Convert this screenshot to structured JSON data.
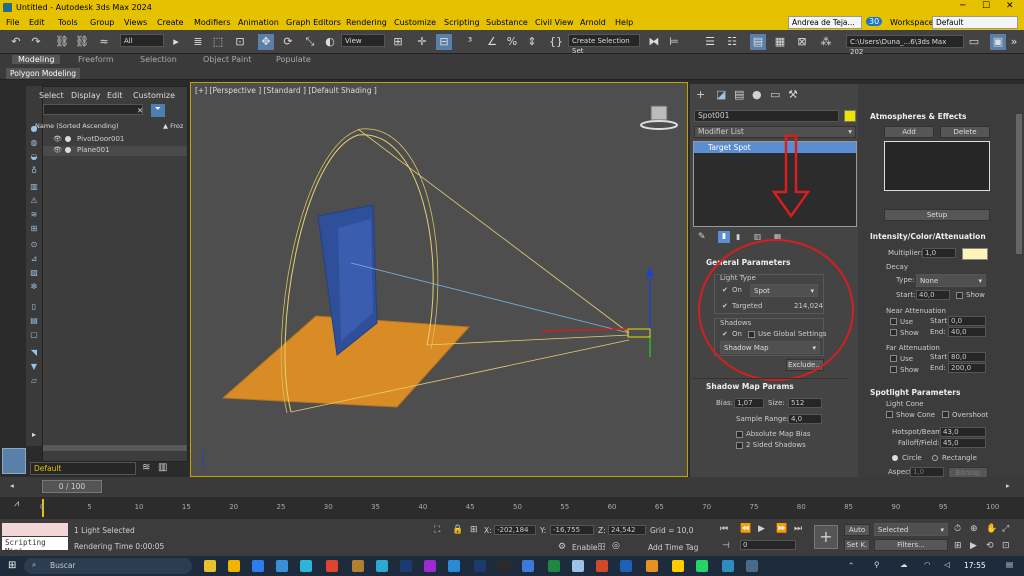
{
  "window": {
    "title": "Untitled - Autodesk 3ds Max 2024",
    "user": "Andrea de Teja...",
    "badge": "30",
    "workspaces_label": "Workspaces:",
    "workspace": "Default"
  },
  "menu": [
    "File",
    "Edit",
    "Tools",
    "Group",
    "Views",
    "Create",
    "Modifiers",
    "Animation",
    "Graph Editors",
    "Rendering",
    "Customize",
    "Scripting",
    "Substance",
    "Civil View",
    "Arnold",
    "Help"
  ],
  "toolbar": {
    "filter": "All",
    "refcoord": "View",
    "selset": "Create Selection Set",
    "path": "C:\\Users\\Duna_...6\\3ds Max 202"
  },
  "ribbon": {
    "tabs": [
      "Modeling",
      "Freeform",
      "Selection",
      "Object Paint",
      "Populate"
    ],
    "sub": "Polygon Modeling"
  },
  "scene": {
    "menu": [
      "Select",
      "Display",
      "Edit",
      "Customize"
    ],
    "column": "Name (Sorted Ascending)",
    "column2": "▲ Froz",
    "items": [
      "PivotDoor001",
      "Plane001"
    ],
    "layer": "Default"
  },
  "viewport": {
    "label": "[+] [Perspective ] [Standard ] [Default Shading ]"
  },
  "command": {
    "object_name": "Spot001",
    "object_color": "#f2e200",
    "modifier_list": "Modifier List",
    "stack_item": "Target Spot",
    "general": {
      "title": "General Parameters",
      "light_type": "Light Type",
      "on": "On",
      "type": "Spot",
      "targeted": "Targeted",
      "target_dist": "214,024",
      "shadows": "Shadows",
      "shadows_on": "On",
      "global": "Use Global Settings",
      "shadow_type": "Shadow Map",
      "exclude": "Exclude..."
    },
    "shadowmap": {
      "title": "Shadow Map Params",
      "bias_label": "Bias:",
      "bias": "1,07",
      "size_label": "Size:",
      "size": "512",
      "sample_label": "Sample Range:",
      "sample": "4,0",
      "abs": "Absolute Map Bias",
      "twosided": "2 Sided Shadows"
    }
  },
  "rollout": {
    "atmos": {
      "title": "Atmospheres & Effects",
      "add": "Add",
      "delete": "Delete",
      "setup": "Setup"
    },
    "intensity": {
      "title": "Intensity/Color/Attenuation",
      "mult_label": "Multiplier:",
      "mult": "1,0",
      "color": "#fff3b8",
      "decay": "Decay",
      "type_label": "Type:",
      "type": "None",
      "start_label": "Start:",
      "start": "40,0",
      "show": "Show",
      "near": "Near Attenuation",
      "use": "Use",
      "start2": "0,0",
      "end_label": "End:",
      "end2": "40,0",
      "far": "Far Attenuation",
      "start3": "80,0",
      "end3": "200,0"
    },
    "spot": {
      "title": "Spotlight Parameters",
      "cone": "Light Cone",
      "showcone": "Show Cone",
      "overshoot": "Overshoot",
      "hotspot_label": "Hotspot/Beam:",
      "hotspot": "43,0",
      "falloff_label": "Falloff/Field:",
      "falloff": "45,0",
      "circle": "Circle",
      "rect": "Rectangle",
      "aspect_label": "Aspect:",
      "aspect": "1,0",
      "bitmap": "Bitmap Fit..."
    }
  },
  "time": {
    "frame": "0 / 100",
    "ticks": [
      "0",
      "5",
      "10",
      "15",
      "20",
      "25",
      "30",
      "35",
      "40",
      "45",
      "50",
      "55",
      "60",
      "65",
      "70",
      "75",
      "80",
      "85",
      "90",
      "95",
      "100"
    ]
  },
  "status": {
    "script": "Scripting Mini",
    "selected": "1 Light Selected",
    "render": "Rendering Time  0:00:05",
    "x_label": "X:",
    "x": "-202,184",
    "y_label": "Y:",
    "y": "-16,755",
    "z_label": "Z:",
    "z": "24,542",
    "grid": "Grid = 10,0",
    "enabled": "Enabled:",
    "addtag": "Add Time Tag",
    "frame": "0",
    "auto": "Auto",
    "setk": "Set K.",
    "selected_dd": "Selected",
    "filters": "Filters..."
  },
  "taskbar": {
    "search": "Buscar",
    "time": "17:55"
  }
}
